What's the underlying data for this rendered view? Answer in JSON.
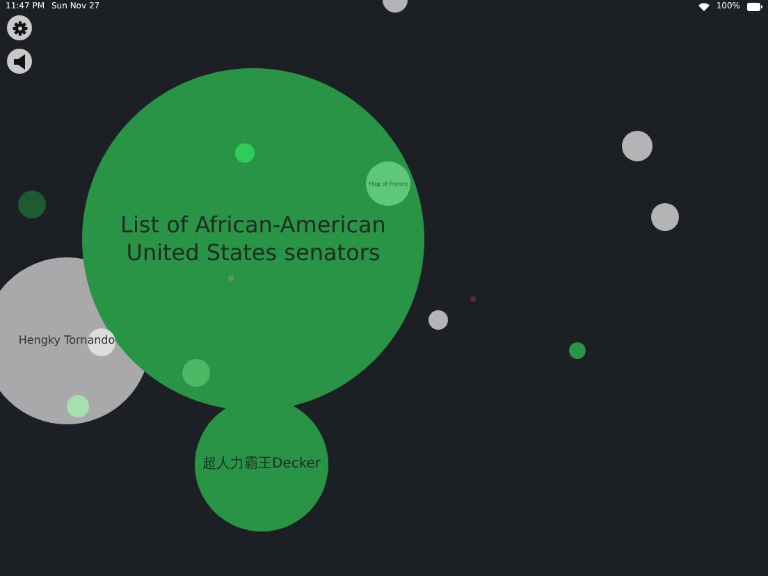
{
  "status_bar": {
    "time": "11:47 PM",
    "date": "Sun Nov 27",
    "battery": "100%"
  },
  "bubbles": [
    {
      "label": "Hengky Tornando",
      "color": "#a9a9ab"
    },
    {
      "label": "List of African-American United States senators",
      "color": "#2a9446"
    },
    {
      "label": "超人力霸王Decker",
      "color": "#2a9446"
    },
    {
      "color": "#2ecc5a"
    },
    {
      "label": "Flag of France",
      "color": "#5fc77a"
    },
    {
      "color": "#4fb866"
    },
    {
      "color": "#a6e0b0"
    },
    {
      "color": "#dcdcdc"
    },
    {
      "color": "#5a9a6a"
    },
    {
      "color": "#1f5a33"
    },
    {
      "color": "#b4b4b6"
    },
    {
      "color": "#b4b4b6"
    },
    {
      "color": "#b4b4b6"
    },
    {
      "color": "#2a9446"
    },
    {
      "color": "#5a2a30"
    },
    {
      "color": "#b4b4b6"
    }
  ]
}
